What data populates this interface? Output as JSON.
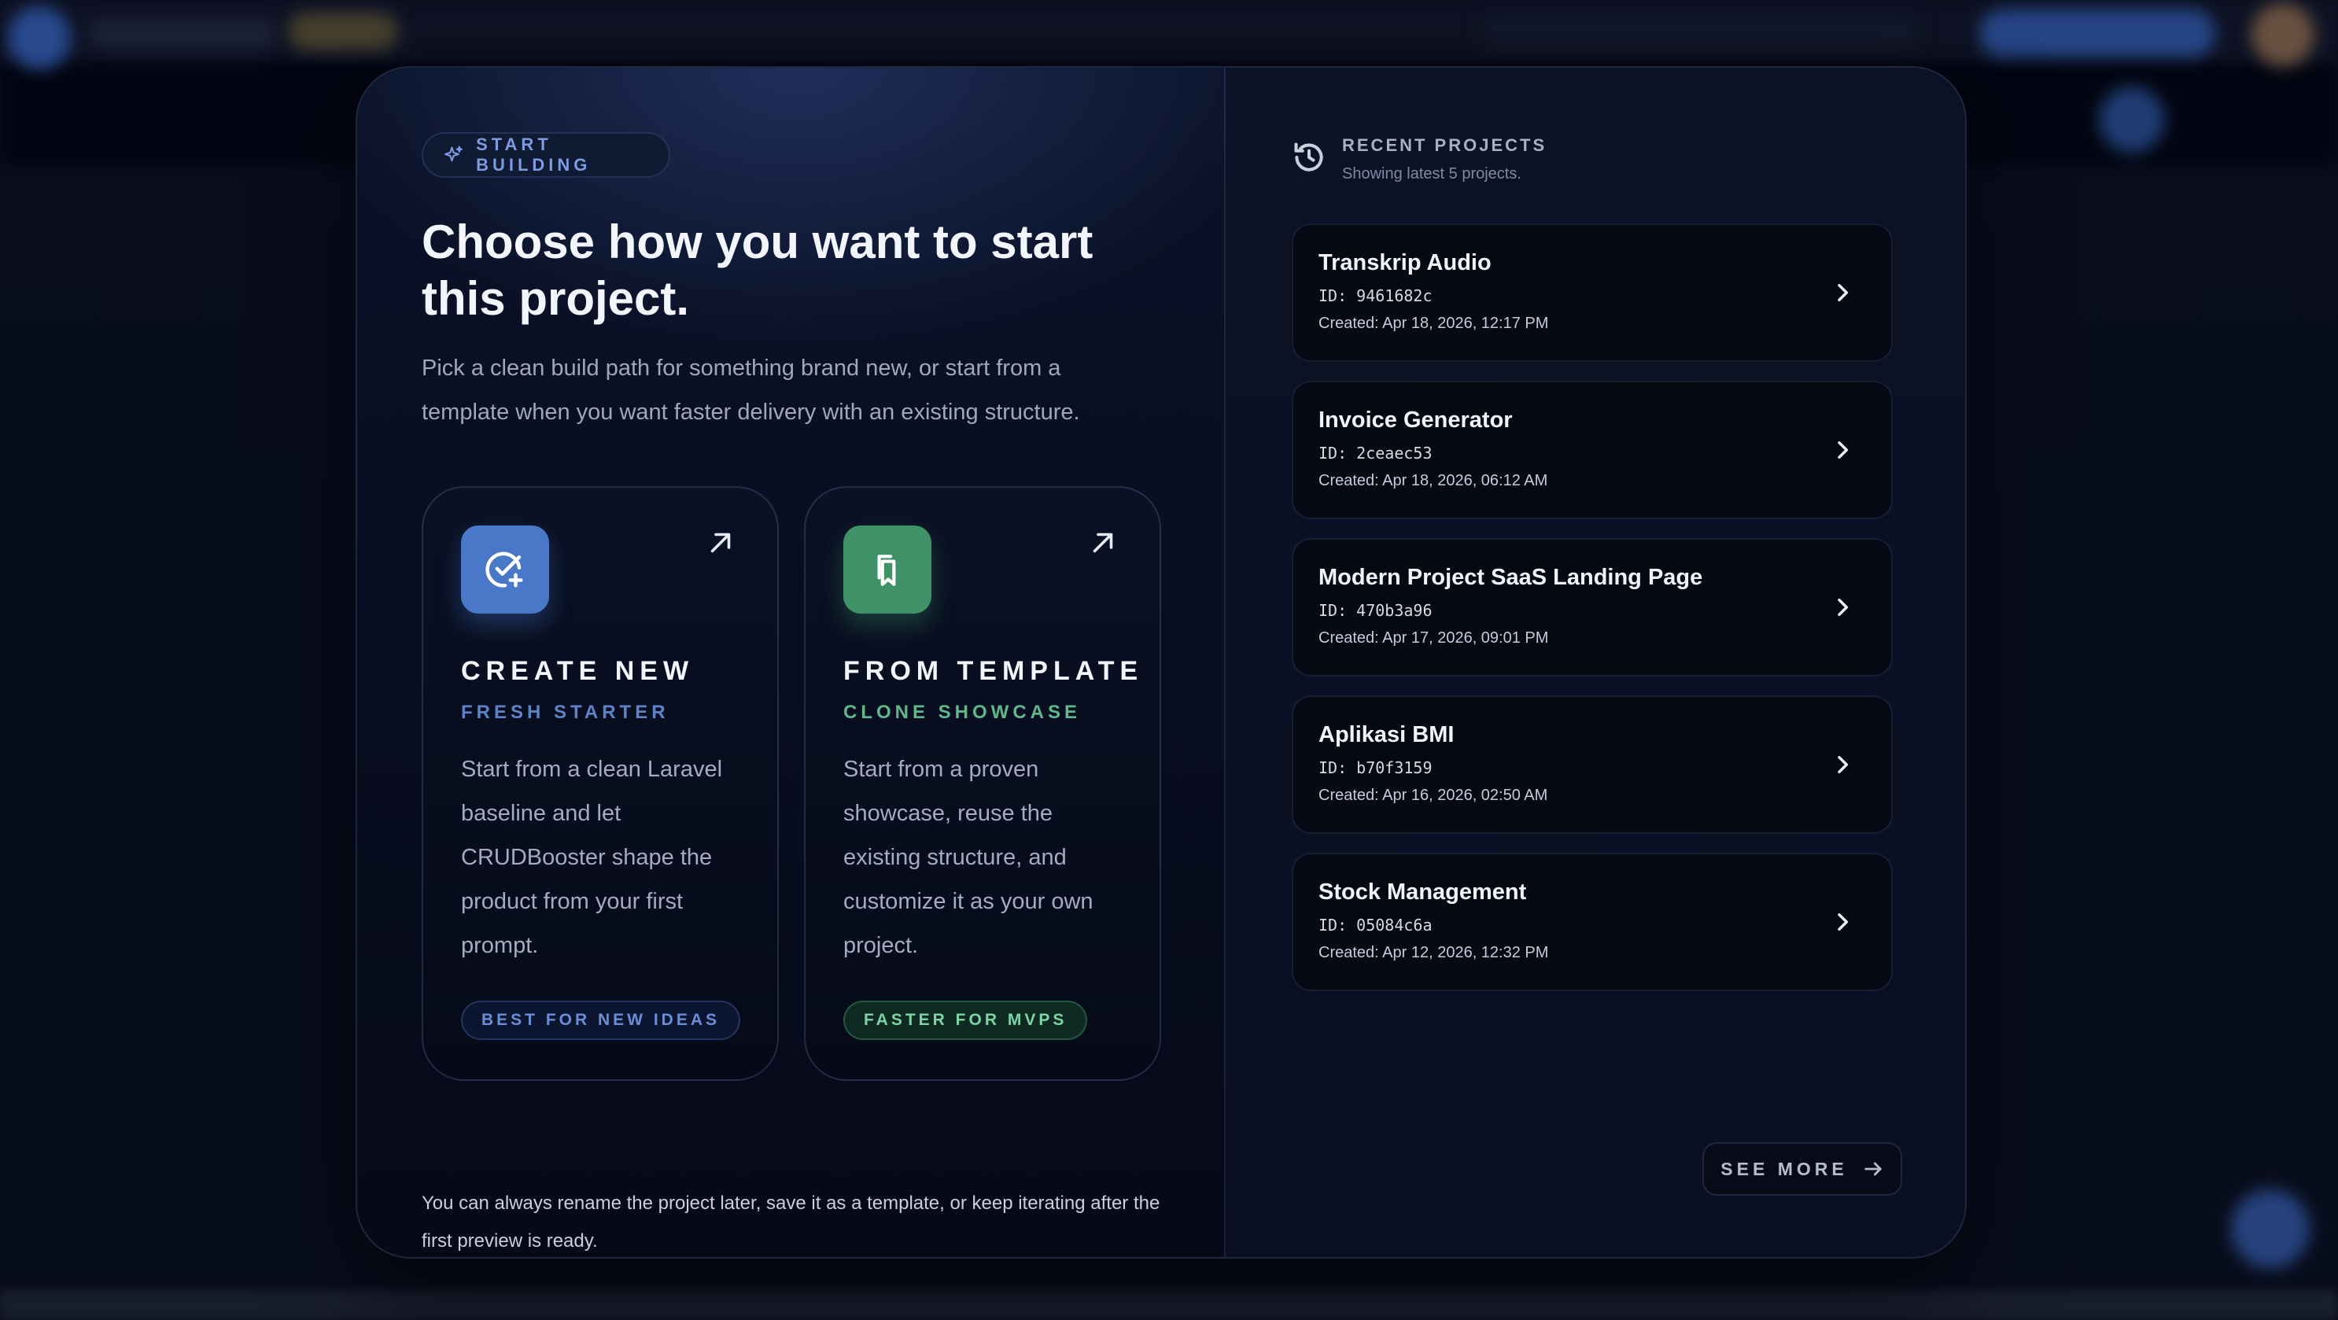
{
  "left": {
    "badge": "START BUILDING",
    "headline": "Choose how you want to start this project.",
    "intro": "Pick a clean build path for something brand new, or start from a template when you want faster delivery with an existing structure.",
    "cards": [
      {
        "title": "CREATE NEW",
        "subtitle": "FRESH STARTER",
        "description": "Start from a clean Laravel baseline and let CRUDBooster shape the product from your first prompt.",
        "tag": "BEST FOR NEW IDEAS",
        "icon": "circle-check-plus-icon",
        "accent": "#4a78c8"
      },
      {
        "title": "FROM TEMPLATE",
        "subtitle": "CLONE SHOWCASE",
        "description": "Start from a proven showcase, reuse the existing structure, and customize it as your own project.",
        "tag": "FASTER FOR MVPS",
        "icon": "bookmarks-icon",
        "accent": "#3f9267"
      }
    ],
    "footnote": "You can always rename the project later, save it as a template, or keep iterating after the first preview is ready."
  },
  "right": {
    "title": "RECENT PROJECTS",
    "subtitle": "Showing latest 5 projects.",
    "projects": [
      {
        "name": "Transkrip Audio",
        "id": "ID: 9461682c",
        "created": "Created: Apr 18, 2026, 12:17 PM"
      },
      {
        "name": "Invoice Generator",
        "id": "ID: 2ceaec53",
        "created": "Created: Apr 18, 2026, 06:12 AM"
      },
      {
        "name": "Modern Project SaaS Landing Page",
        "id": "ID: 470b3a96",
        "created": "Created: Apr 17, 2026, 09:01 PM"
      },
      {
        "name": "Aplikasi BMI",
        "id": "ID: b70f3159",
        "created": "Created: Apr 16, 2026, 02:50 AM"
      },
      {
        "name": "Stock Management",
        "id": "ID: 05084c6a",
        "created": "Created: Apr 12, 2026, 12:32 PM"
      }
    ],
    "see_more": "SEE MORE"
  }
}
